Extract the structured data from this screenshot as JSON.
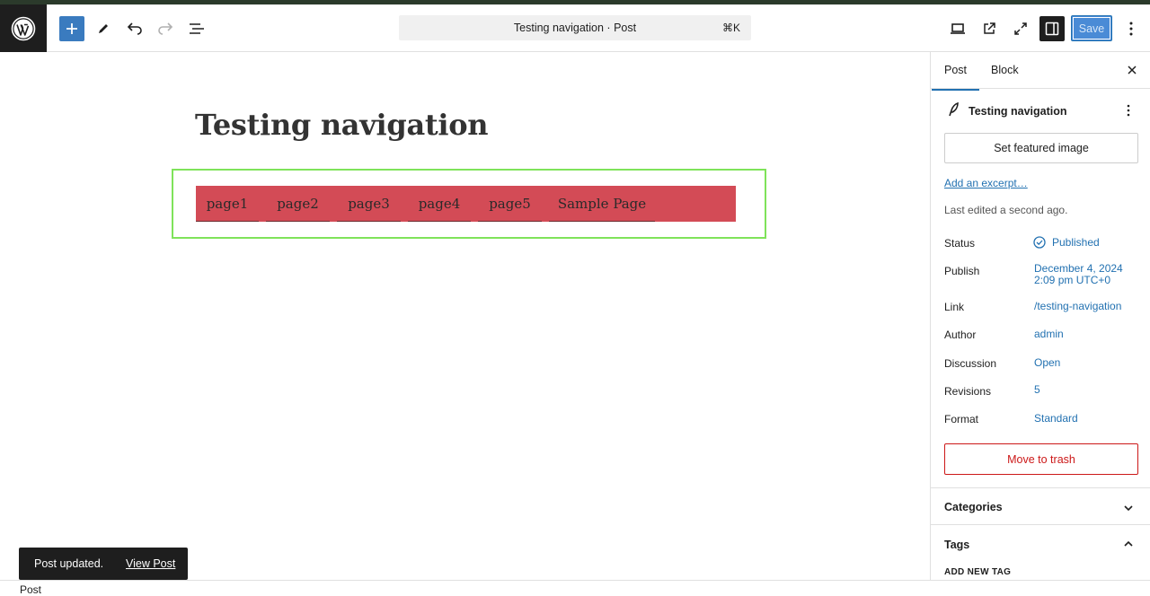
{
  "toolbar": {
    "command_title": "Testing navigation · Post",
    "command_shortcut": "⌘K",
    "save_label": "Save"
  },
  "post": {
    "title": "Testing navigation",
    "nav_items": [
      "page1",
      "page2",
      "page3",
      "page4",
      "page5",
      "Sample Page"
    ]
  },
  "sidebar": {
    "tabs": [
      "Post",
      "Block"
    ],
    "post_name": "Testing navigation",
    "featured_image_label": "Set featured image",
    "excerpt_link": "Add an excerpt…",
    "last_edited": "Last edited a second ago.",
    "rows": [
      {
        "label": "Status",
        "value": "Published"
      },
      {
        "label": "Publish",
        "value": "December 4, 2024",
        "value2": "2:09 pm UTC+0"
      },
      {
        "label": "Link",
        "value": "/testing-navigation"
      },
      {
        "label": "Author",
        "value": "admin"
      },
      {
        "label": "Discussion",
        "value": "Open"
      },
      {
        "label": "Revisions",
        "value": "5"
      },
      {
        "label": "Format",
        "value": "Standard"
      }
    ],
    "trash_label": "Move to trash",
    "categories_label": "Categories",
    "tags_label": "Tags",
    "add_new_tag": "ADD NEW TAG"
  },
  "snackbar": {
    "message": "Post updated.",
    "link": "View Post"
  },
  "footer": {
    "breadcrumb": "Post"
  },
  "colors": {
    "accent": "#2271b1",
    "nav_background": "#d34b56",
    "block_outline": "#7fe35a",
    "danger": "#cc1818"
  }
}
